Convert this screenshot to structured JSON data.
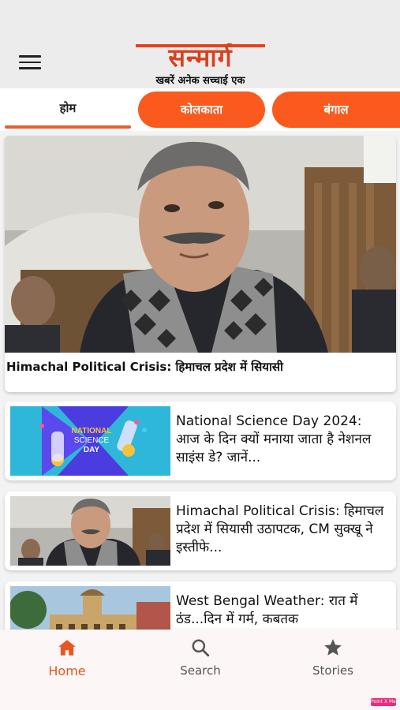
{
  "header": {
    "logo_text": "सन्मार्ग",
    "tagline": "खबरें अनेक सच्चाई एक"
  },
  "tabs": [
    {
      "label": "होम",
      "active": true
    },
    {
      "label": "कोलकाता",
      "active": false
    },
    {
      "label": "बंगाल",
      "active": false
    }
  ],
  "hero": {
    "title": "Himachal Political Crisis: हिमाचल प्रदेश में सियासी"
  },
  "articles": [
    {
      "title": "National Science Day 2024: आज के दिन क्यों मनाया जाता है नेशनल साइंस डे? जानें...",
      "image_text": "NATIONAL SCIENCE DAY"
    },
    {
      "title": "Himachal Political Crisis: हिमाचल प्रदेश में सियासी उठापटक, CM सुक्खू ने इस्तीफे..."
    },
    {
      "title": "West Bengal Weather: रात में ठंड...दिन में गर्म, कबतक"
    }
  ],
  "bottom_nav": [
    {
      "label": "Home",
      "icon": "home-icon",
      "active": true
    },
    {
      "label": "Search",
      "icon": "search-icon",
      "active": false
    },
    {
      "label": "Stories",
      "icon": "star-icon",
      "active": false
    }
  ],
  "badge_text": "Point X Me",
  "colors": {
    "accent": "#fa5a1e",
    "brand": "#d6421c",
    "active_nav": "#e8551e"
  }
}
